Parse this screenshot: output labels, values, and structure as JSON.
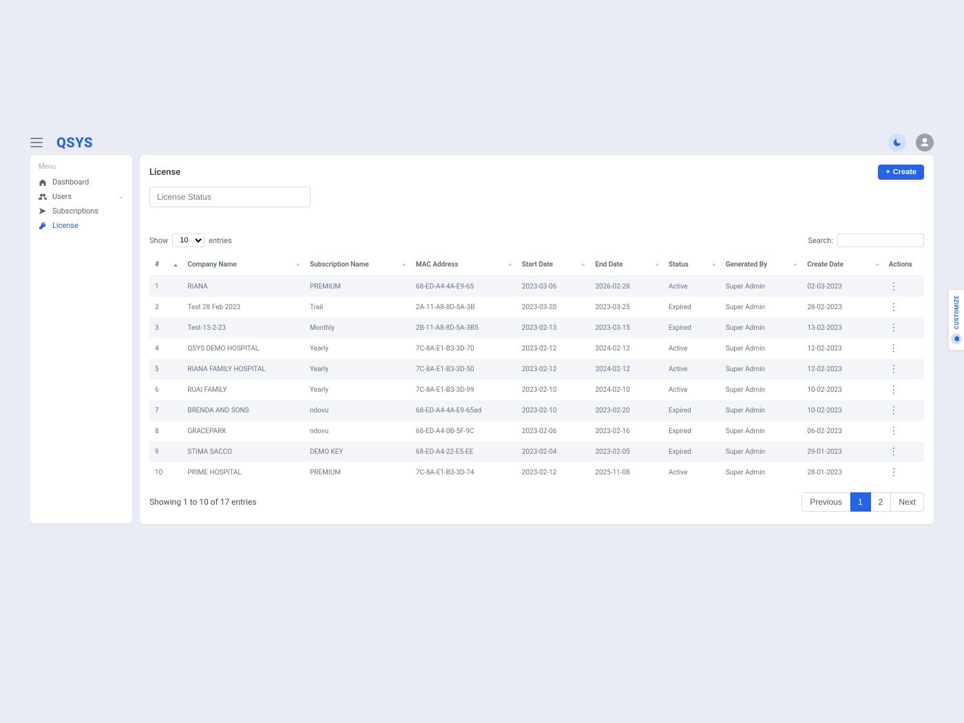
{
  "brand": "QSYS",
  "sidebar": {
    "menu_label": "Menu",
    "items": [
      {
        "label": "Dashboard",
        "active": false
      },
      {
        "label": "Users",
        "active": false,
        "expandable": true
      },
      {
        "label": "Subscriptions",
        "active": false
      },
      {
        "label": "License",
        "active": true
      }
    ]
  },
  "page": {
    "title": "License",
    "create_label": "Create",
    "status_filter_placeholder": "License Status"
  },
  "table_controls": {
    "show_label": "Show",
    "entries_label": "entries",
    "show_value": "10",
    "search_label": "Search:"
  },
  "columns": [
    "#",
    "Company Name",
    "Subscription Name",
    "MAC Address",
    "Start Date",
    "End Date",
    "Status",
    "Generated By",
    "Create Date",
    "Actions"
  ],
  "rows": [
    {
      "n": "1",
      "company": "RIANA",
      "sub": "PREMIUM",
      "mac": "68-ED-A4-4A-E9-65",
      "start": "2023-03-06",
      "end": "2026-02-28",
      "status": "Active",
      "gen": "Super Admin",
      "cdate": "02-03-2023"
    },
    {
      "n": "2",
      "company": "Test 28 Feb 2023",
      "sub": "Trail",
      "mac": "2A-11-A8-8D-5A-3B",
      "start": "2023-03-20",
      "end": "2023-03-25",
      "status": "Expired",
      "gen": "Super Admin",
      "cdate": "28-02-2023"
    },
    {
      "n": "3",
      "company": "Test-13-2-23",
      "sub": "Monthly",
      "mac": "2B-11-A8-8D-5A-3B5",
      "start": "2023-02-13",
      "end": "2023-03-15",
      "status": "Expired",
      "gen": "Super Admin",
      "cdate": "13-02-2023"
    },
    {
      "n": "4",
      "company": "QSYS DEMO HOSPITAL",
      "sub": "Yearly",
      "mac": "7C-8A-E1-B3-3D-70",
      "start": "2023-02-12",
      "end": "2024-02-12",
      "status": "Active",
      "gen": "Super Admin",
      "cdate": "12-02-2023"
    },
    {
      "n": "5",
      "company": "RIANA FAMILY HOSPITAL",
      "sub": "Yearly",
      "mac": "7C-8A-E1-B3-3D-50",
      "start": "2023-02-12",
      "end": "2024-02-12",
      "status": "Active",
      "gen": "Super Admin",
      "cdate": "12-02-2023"
    },
    {
      "n": "6",
      "company": "RUAI FAMILY",
      "sub": "Yearly",
      "mac": "7C-8A-E1-B3-3D-99",
      "start": "2023-02-10",
      "end": "2024-02-10",
      "status": "Active",
      "gen": "Super Admin",
      "cdate": "10-02-2023"
    },
    {
      "n": "7",
      "company": "BRENDA AND SONS",
      "sub": "ndovu",
      "mac": "68-ED-A4-4A-E9-65ad",
      "start": "2023-02-10",
      "end": "2023-02-20",
      "status": "Expired",
      "gen": "Super Admin",
      "cdate": "10-02-2023"
    },
    {
      "n": "8",
      "company": "GRACEPARK",
      "sub": "ndovu",
      "mac": "68-ED-A4-0B-5F-9C",
      "start": "2023-02-06",
      "end": "2023-02-16",
      "status": "Expired",
      "gen": "Super Admin",
      "cdate": "06-02-2023"
    },
    {
      "n": "9",
      "company": "STIMA SACCO",
      "sub": "DEMO KEY",
      "mac": "68-ED-A4-22-E5-EE",
      "start": "2023-02-04",
      "end": "2023-02-05",
      "status": "Expired",
      "gen": "Super Admin",
      "cdate": "29-01-2023"
    },
    {
      "n": "10",
      "company": "PRIME HOSPITAL",
      "sub": "PREMIUM",
      "mac": "7C-8A-E1-B3-3D-74",
      "start": "2023-02-12",
      "end": "2025-11-08",
      "status": "Active",
      "gen": "Super Admin",
      "cdate": "28-01-2023"
    }
  ],
  "footer": {
    "info": "Showing 1 to 10 of 17 entries",
    "prev": "Previous",
    "next": "Next",
    "pages": [
      "1",
      "2"
    ],
    "current": "1"
  },
  "customize": {
    "label": "CUSTOMIZE"
  }
}
